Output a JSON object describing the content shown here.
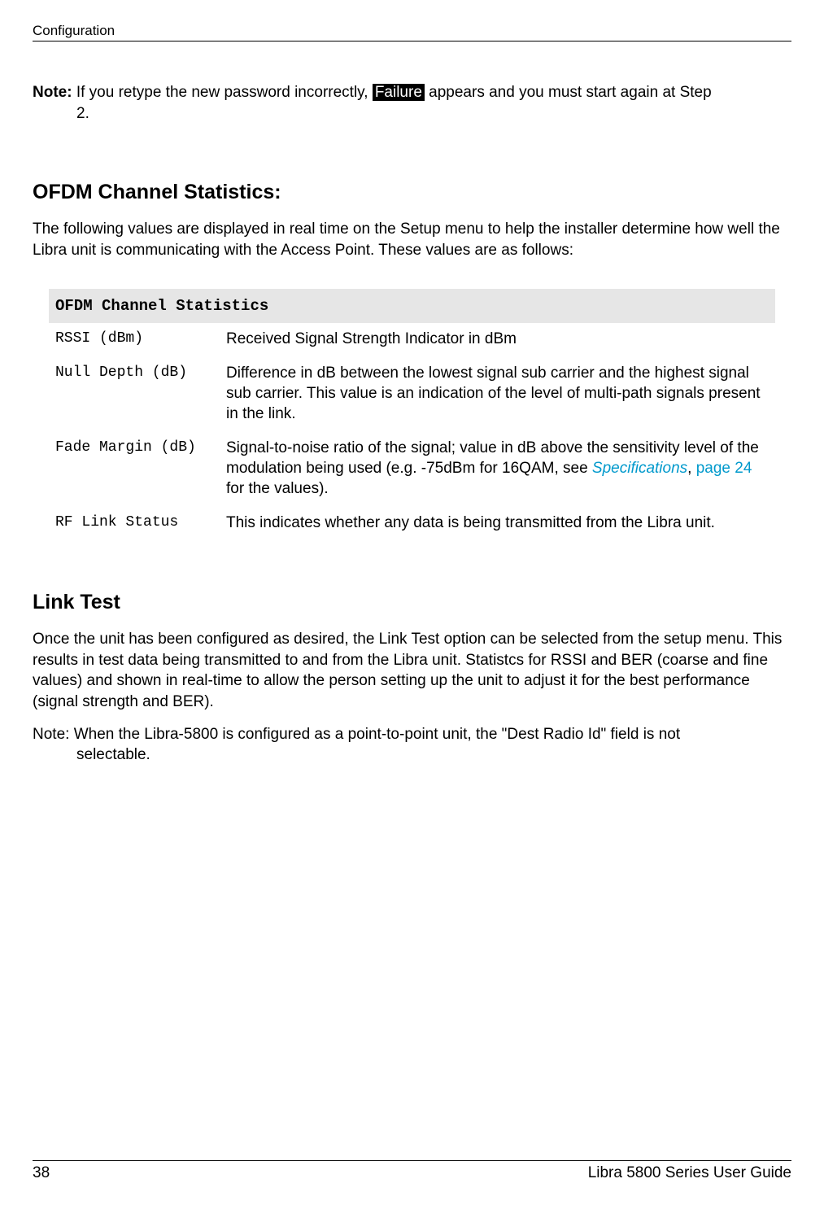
{
  "header": {
    "left": "Configuration"
  },
  "note1": {
    "label": "Note: ",
    "part1": "If you retype the new password incorrectly, ",
    "highlight": "Failure",
    "part2": " appears and you must start again at Step",
    "line2": "2."
  },
  "ofdm": {
    "heading": "OFDM Channel Statistics:",
    "intro": "The following values are displayed in real time on the Setup menu to help the installer determine how well the Libra unit is communicating with the Access Point. These values are as follows:",
    "table_title": "OFDM Channel Statistics",
    "rows": [
      {
        "label": "RSSI (dBm)",
        "desc": "Received Signal Strength Indicator in dBm"
      },
      {
        "label": "Null Depth (dB)",
        "desc": "Difference in dB between the lowest signal sub carrier and the highest signal sub carrier. This value is an indication of the level of multi-path signals present in the link."
      },
      {
        "label": "Fade Margin (dB)",
        "desc_pre": "Signal-to-noise ratio of the signal; value in dB above the sensitivity level of the modulation being used (e.g. -75dBm for 16QAM, see ",
        "link1": "Specifications",
        "between": ", ",
        "link2": "page 24",
        "desc_post": " for the values)."
      },
      {
        "label": "RF Link Status",
        "desc": "This indicates whether any data is being transmitted from the Libra unit."
      }
    ]
  },
  "linktest": {
    "heading": "Link Test",
    "para": "Once the unit has been configured as desired, the Link Test option can be selected from the setup menu. This results in test data being transmitted to and from the Libra unit. Statistcs for RSSI and BER (coarse and fine values) and shown in real-time to allow the person setting up the unit to adjust it for the best performance (signal strength and BER).",
    "note_line1": "Note: When the Libra-5800 is configured as a point-to-point unit, the \"Dest Radio Id\" field is not",
    "note_line2": "selectable."
  },
  "footer": {
    "page": "38",
    "title": "Libra 5800 Series User Guide"
  }
}
